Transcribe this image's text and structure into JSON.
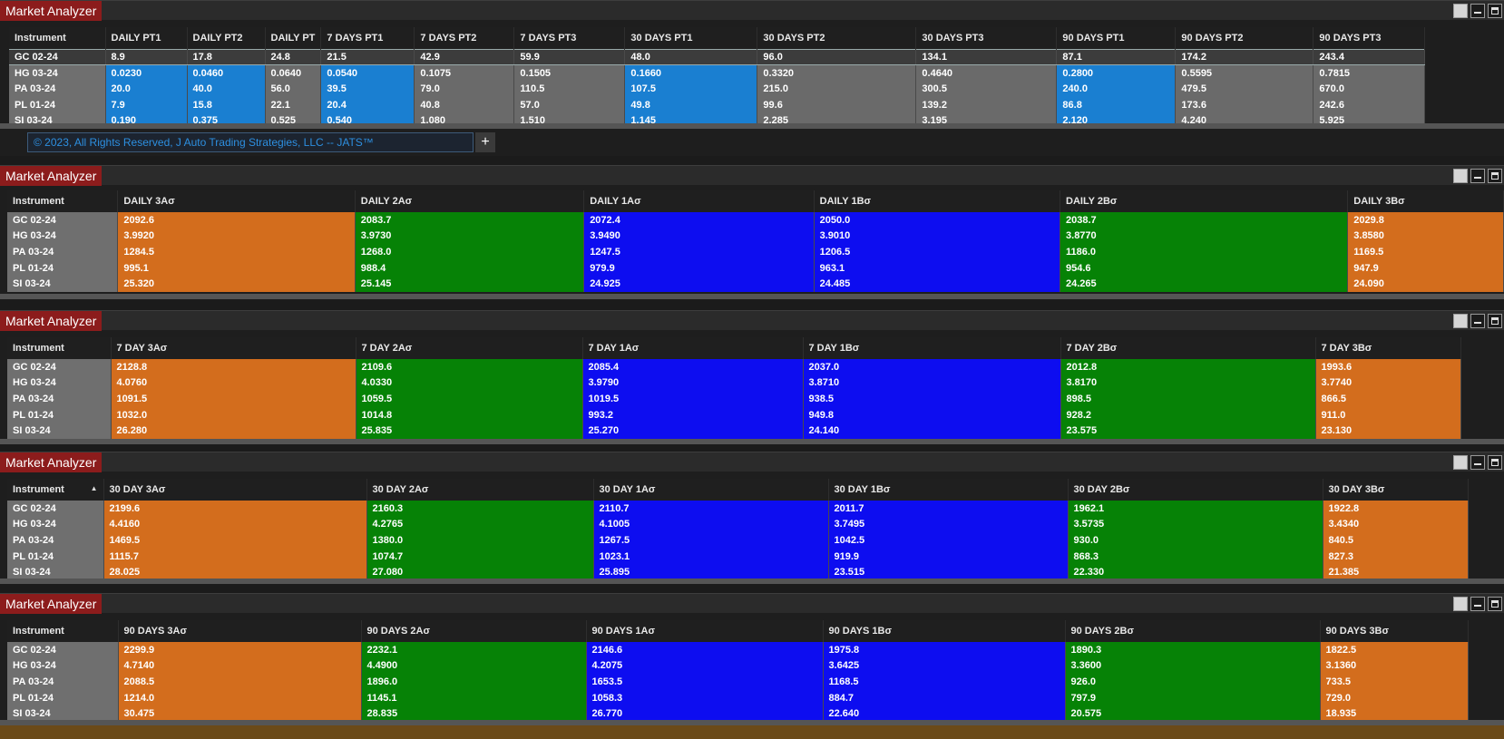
{
  "copyright": "© 2023, All Rights Reserved, J Auto Trading Strategies, LLC -- JATS™",
  "add_tab_label": "+",
  "panels": [
    {
      "title": "Market Analyzer",
      "instrument_header": "Instrument",
      "columns": [
        "DAILY PT1",
        "DAILY PT2",
        "DAILY PT",
        "7 DAYS PT1",
        "7 DAYS PT2",
        "7 DAYS PT3",
        "30 DAYS PT1",
        "30 DAYS PT2",
        "30 DAYS PT3",
        "90 DAYS PT1",
        "90 DAYS PT2",
        "90 DAYS PT3"
      ],
      "rows": [
        {
          "instrument": "GC 02-24",
          "values": [
            "8.9",
            "17.8",
            "24.8",
            "21.5",
            "42.9",
            "59.9",
            "48.0",
            "96.0",
            "134.1",
            "87.1",
            "174.2",
            "243.4"
          ]
        },
        {
          "instrument": "HG 03-24",
          "values": [
            "0.0230",
            "0.0460",
            "0.0640",
            "0.0540",
            "0.1075",
            "0.1505",
            "0.1660",
            "0.3320",
            "0.4640",
            "0.2800",
            "0.5595",
            "0.7815"
          ]
        },
        {
          "instrument": "PA 03-24",
          "values": [
            "20.0",
            "40.0",
            "56.0",
            "39.5",
            "79.0",
            "110.5",
            "107.5",
            "215.0",
            "300.5",
            "240.0",
            "479.5",
            "670.0"
          ]
        },
        {
          "instrument": "PL 01-24",
          "values": [
            "7.9",
            "15.8",
            "22.1",
            "20.4",
            "40.8",
            "57.0",
            "49.8",
            "99.6",
            "139.2",
            "86.8",
            "173.6",
            "242.6"
          ]
        },
        {
          "instrument": "SI 03-24",
          "values": [
            "0.190",
            "0.375",
            "0.525",
            "0.540",
            "1.080",
            "1.510",
            "1.145",
            "2.285",
            "3.195",
            "2.120",
            "4.240",
            "5.925"
          ]
        }
      ]
    },
    {
      "title": "Market Analyzer",
      "instrument_header": "Instrument",
      "columns": [
        "DAILY 3Aσ",
        "DAILY 2Aσ",
        "DAILY 1Aσ",
        "DAILY 1Bσ",
        "DAILY 2Bσ",
        "DAILY 3Bσ"
      ],
      "rows": [
        {
          "instrument": "GC 02-24",
          "values": [
            "2092.6",
            "2083.7",
            "2072.4",
            "2050.0",
            "2038.7",
            "2029.8"
          ]
        },
        {
          "instrument": "HG 03-24",
          "values": [
            "3.9920",
            "3.9730",
            "3.9490",
            "3.9010",
            "3.8770",
            "3.8580"
          ]
        },
        {
          "instrument": "PA 03-24",
          "values": [
            "1284.5",
            "1268.0",
            "1247.5",
            "1206.5",
            "1186.0",
            "1169.5"
          ]
        },
        {
          "instrument": "PL 01-24",
          "values": [
            "995.1",
            "988.4",
            "979.9",
            "963.1",
            "954.6",
            "947.9"
          ]
        },
        {
          "instrument": "SI 03-24",
          "values": [
            "25.320",
            "25.145",
            "24.925",
            "24.485",
            "24.265",
            "24.090"
          ]
        }
      ]
    },
    {
      "title": "Market Analyzer",
      "instrument_header": "Instrument",
      "columns": [
        "7 DAY 3Aσ",
        "7 DAY 2Aσ",
        "7 DAY 1Aσ",
        "7 DAY 1Bσ",
        "7 DAY 2Bσ",
        "7 DAY 3Bσ"
      ],
      "rows": [
        {
          "instrument": "GC 02-24",
          "values": [
            "2128.8",
            "2109.6",
            "2085.4",
            "2037.0",
            "2012.8",
            "1993.6"
          ]
        },
        {
          "instrument": "HG 03-24",
          "values": [
            "4.0760",
            "4.0330",
            "3.9790",
            "3.8710",
            "3.8170",
            "3.7740"
          ]
        },
        {
          "instrument": "PA 03-24",
          "values": [
            "1091.5",
            "1059.5",
            "1019.5",
            "938.5",
            "898.5",
            "866.5"
          ]
        },
        {
          "instrument": "PL 01-24",
          "values": [
            "1032.0",
            "1014.8",
            "993.2",
            "949.8",
            "928.2",
            "911.0"
          ]
        },
        {
          "instrument": "SI 03-24",
          "values": [
            "26.280",
            "25.835",
            "25.270",
            "24.140",
            "23.575",
            "23.130"
          ]
        }
      ]
    },
    {
      "title": "Market Analyzer",
      "instrument_header": "Instrument",
      "columns": [
        "30 DAY 3Aσ",
        "30 DAY 2Aσ",
        "30 DAY 1Aσ",
        "30 DAY 1Bσ",
        "30 DAY 2Bσ",
        "30 DAY 3Bσ"
      ],
      "rows": [
        {
          "instrument": "GC 02-24",
          "values": [
            "2199.6",
            "2160.3",
            "2110.7",
            "2011.7",
            "1962.1",
            "1922.8"
          ]
        },
        {
          "instrument": "HG 03-24",
          "values": [
            "4.4160",
            "4.2765",
            "4.1005",
            "3.7495",
            "3.5735",
            "3.4340"
          ]
        },
        {
          "instrument": "PA 03-24",
          "values": [
            "1469.5",
            "1380.0",
            "1267.5",
            "1042.5",
            "930.0",
            "840.5"
          ]
        },
        {
          "instrument": "PL 01-24",
          "values": [
            "1115.7",
            "1074.7",
            "1023.1",
            "919.9",
            "868.3",
            "827.3"
          ]
        },
        {
          "instrument": "SI 03-24",
          "values": [
            "28.025",
            "27.080",
            "25.895",
            "23.515",
            "22.330",
            "21.385"
          ]
        }
      ]
    },
    {
      "title": "Market Analyzer",
      "instrument_header": "Instrument",
      "columns": [
        "90 DAYS 3Aσ",
        "90 DAYS 2Aσ",
        "90 DAYS 1Aσ",
        "90 DAYS 1Bσ",
        "90 DAYS 2Bσ",
        "90 DAYS 3Bσ"
      ],
      "rows": [
        {
          "instrument": "GC 02-24",
          "values": [
            "2299.9",
            "2232.1",
            "2146.6",
            "1975.8",
            "1890.3",
            "1822.5"
          ]
        },
        {
          "instrument": "HG 03-24",
          "values": [
            "4.7140",
            "4.4900",
            "4.2075",
            "3.6425",
            "3.3600",
            "3.1360"
          ]
        },
        {
          "instrument": "PA 03-24",
          "values": [
            "2088.5",
            "1896.0",
            "1653.5",
            "1168.5",
            "926.0",
            "733.5"
          ]
        },
        {
          "instrument": "PL 01-24",
          "values": [
            "1214.0",
            "1145.1",
            "1058.3",
            "884.7",
            "797.9",
            "729.0"
          ]
        },
        {
          "instrument": "SI 03-24",
          "values": [
            "30.475",
            "28.835",
            "26.770",
            "22.640",
            "20.575",
            "18.935"
          ]
        }
      ]
    }
  ],
  "colors": {
    "title_bg": "#8c1c1c",
    "orange": "#d36d1d",
    "green": "#068206",
    "blue": "#0d0df0",
    "light_blue": "#1a7fd1",
    "gray": "#6a6a6a"
  }
}
